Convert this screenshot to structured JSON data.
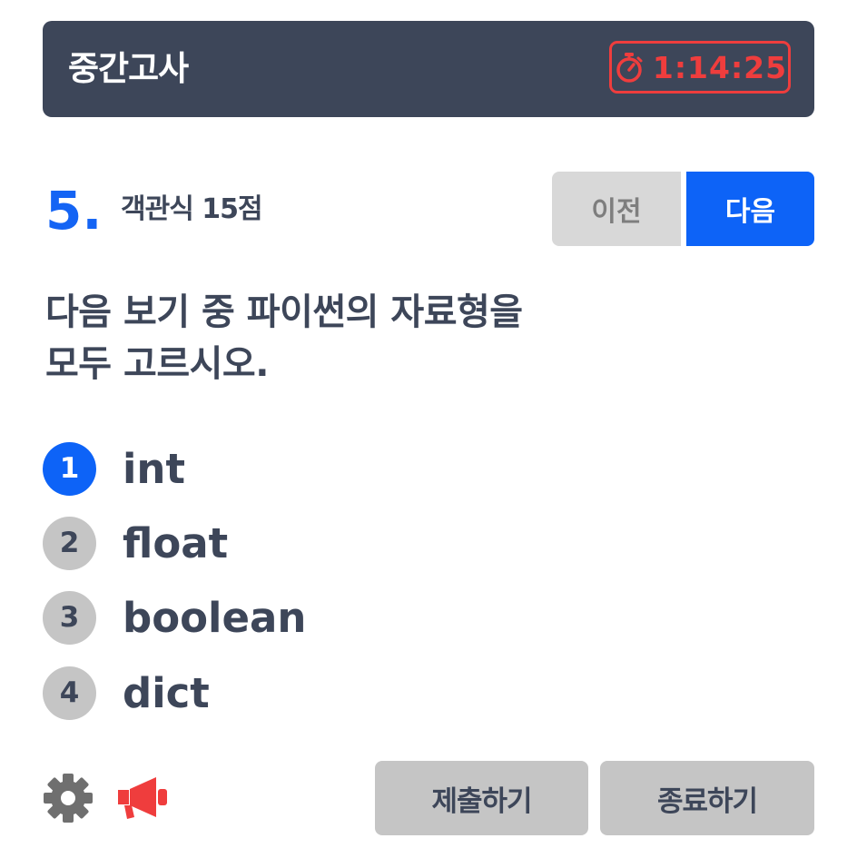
{
  "header": {
    "title": "중간고사",
    "timer": "1:14:25"
  },
  "question": {
    "number": "5.",
    "meta": "객관식 15점",
    "text_lines": [
      "다음 보기 중 파이썬의 자료형을",
      "모두 고르시오."
    ]
  },
  "nav": {
    "prev_label": "이전",
    "next_label": "다음"
  },
  "options": [
    {
      "num": "1",
      "label": "int",
      "selected": true
    },
    {
      "num": "2",
      "label": "float",
      "selected": false
    },
    {
      "num": "3",
      "label": "boolean",
      "selected": false
    },
    {
      "num": "4",
      "label": "dict",
      "selected": false
    }
  ],
  "footer": {
    "settings_icon": "gear-icon",
    "report_icon": "megaphone-icon",
    "submit_label": "제출하기",
    "exit_label": "종료하기"
  },
  "colors": {
    "header_bg": "#3d4659",
    "accent": "#0d63f7",
    "timer": "#ef3d3d",
    "neutral": "#c5c5c5"
  }
}
